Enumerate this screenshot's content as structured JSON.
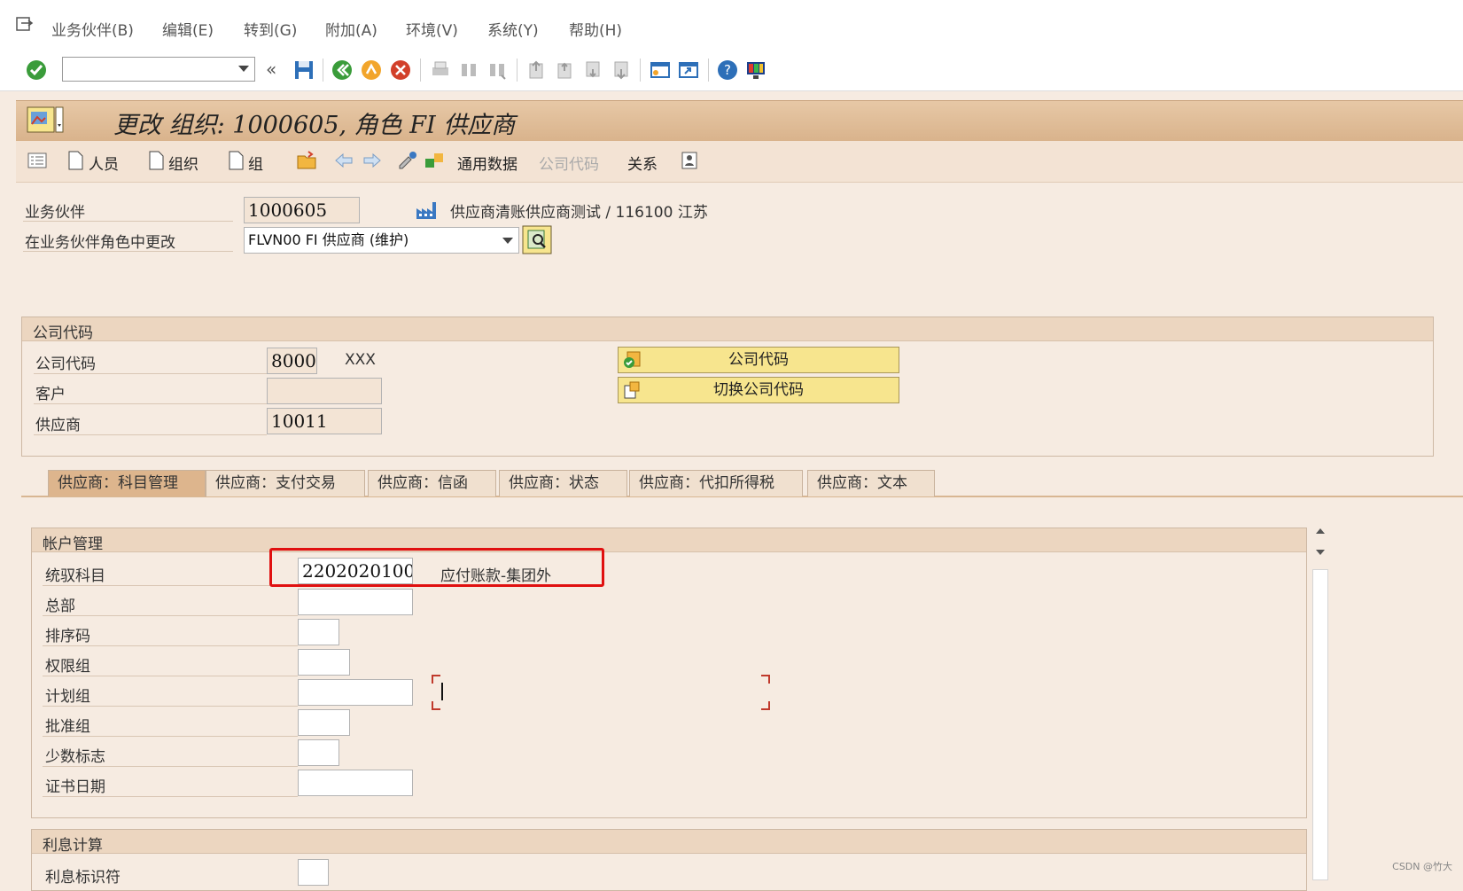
{
  "menu": {
    "items": [
      "业务伙伴(B)",
      "编辑(E)",
      "转到(G)",
      "附加(A)",
      "环境(V)",
      "系统(Y)",
      "帮助(H)"
    ]
  },
  "command": {
    "value": ""
  },
  "title": "更改 组织: 1000605, 角色 FI 供应商",
  "toolbar2": {
    "person": "人员",
    "org": "组织",
    "group": "组",
    "general_data": "通用数据",
    "company_code": "公司代码",
    "relations": "关系"
  },
  "header": {
    "bp_label": "业务伙伴",
    "bp_value": "1000605",
    "bp_desc": "供应商清账供应商测试 / 116100 江苏",
    "role_label": "在业务伙伴角色中更改",
    "role_value": "FLVN00 FI 供应商 (维护)"
  },
  "company_group": {
    "title": "公司代码",
    "cc_label": "公司代码",
    "cc_value": "8000",
    "cc_desc": "XXX",
    "customer_label": "客户",
    "customer_value": "",
    "vendor_label": "供应商",
    "vendor_value": "10011",
    "btn_company_code": "公司代码",
    "btn_switch": "切换公司代码"
  },
  "tabs": [
    "供应商：科目管理",
    "供应商：支付交易",
    "供应商：信函",
    "供应商：状态",
    "供应商：代扣所得税",
    "供应商：文本"
  ],
  "account_mgmt": {
    "title": "帐户管理",
    "recon_label": "统驭科目",
    "recon_value": "2202020100",
    "recon_desc": "应付账款-集团外",
    "hq_label": "总部",
    "sort_label": "排序码",
    "auth_label": "权限组",
    "plan_label": "计划组",
    "approve_label": "批准组",
    "minority_label": "少数标志",
    "cert_label": "证书日期"
  },
  "interest": {
    "title": "利息计算",
    "indicator_label": "利息标识符"
  },
  "watermark": "CSDN @竹大"
}
